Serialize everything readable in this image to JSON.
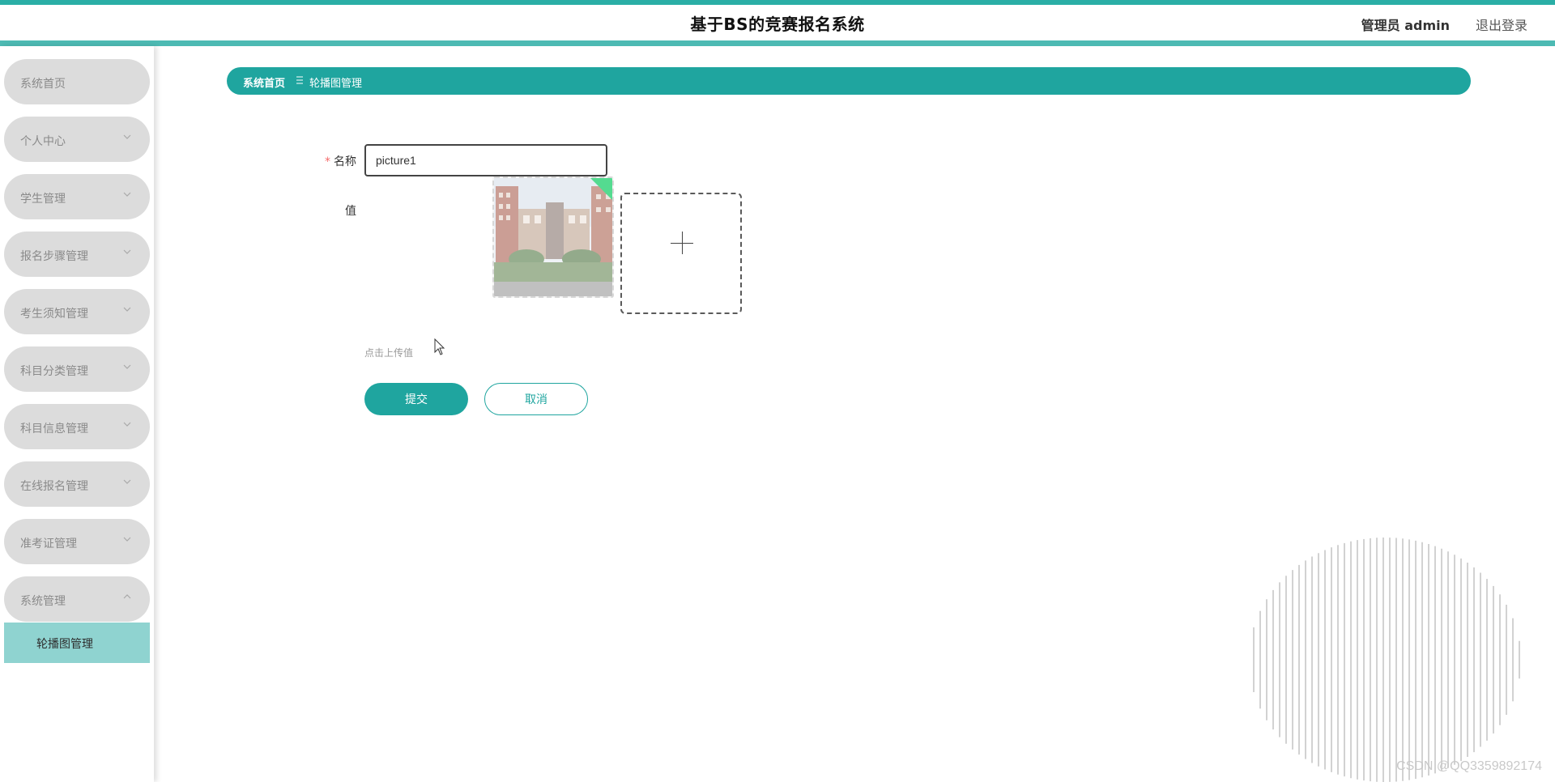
{
  "header": {
    "title": "基于BS的竞赛报名系统",
    "user": "管理员 admin",
    "logout": "退出登录"
  },
  "sidebar": {
    "items": [
      {
        "label": "系统首页",
        "icon": ""
      },
      {
        "label": "个人中心",
        "icon": "chevron-down-icon"
      },
      {
        "label": "学生管理",
        "icon": "chevron-down-icon"
      },
      {
        "label": "报名步骤管理",
        "icon": "chevron-down-icon"
      },
      {
        "label": "考生须知管理",
        "icon": "chevron-down-icon"
      },
      {
        "label": "科目分类管理",
        "icon": "chevron-down-icon"
      },
      {
        "label": "科目信息管理",
        "icon": "chevron-down-icon"
      },
      {
        "label": "在线报名管理",
        "icon": "chevron-down-icon"
      },
      {
        "label": "准考证管理",
        "icon": "chevron-down-icon"
      },
      {
        "label": "系统管理",
        "icon": "chevron-up-icon"
      }
    ],
    "submenu": {
      "label": "轮播图管理"
    }
  },
  "breadcrumb": {
    "home": "系统首页",
    "separator_icon": "menu-icon",
    "current": "轮播图管理"
  },
  "form": {
    "name_label": "名称",
    "name_required_mark": "*",
    "name_value": "picture1",
    "value_label": "值",
    "upload_hint": "点击上传值",
    "submit_label": "提交",
    "cancel_label": "取消"
  },
  "watermark": "CSDN @QQ3359892174",
  "colors": {
    "accent": "#1fa59f",
    "menu_bg": "#dcdcdc",
    "submenu_active": "#8fd3d0"
  }
}
